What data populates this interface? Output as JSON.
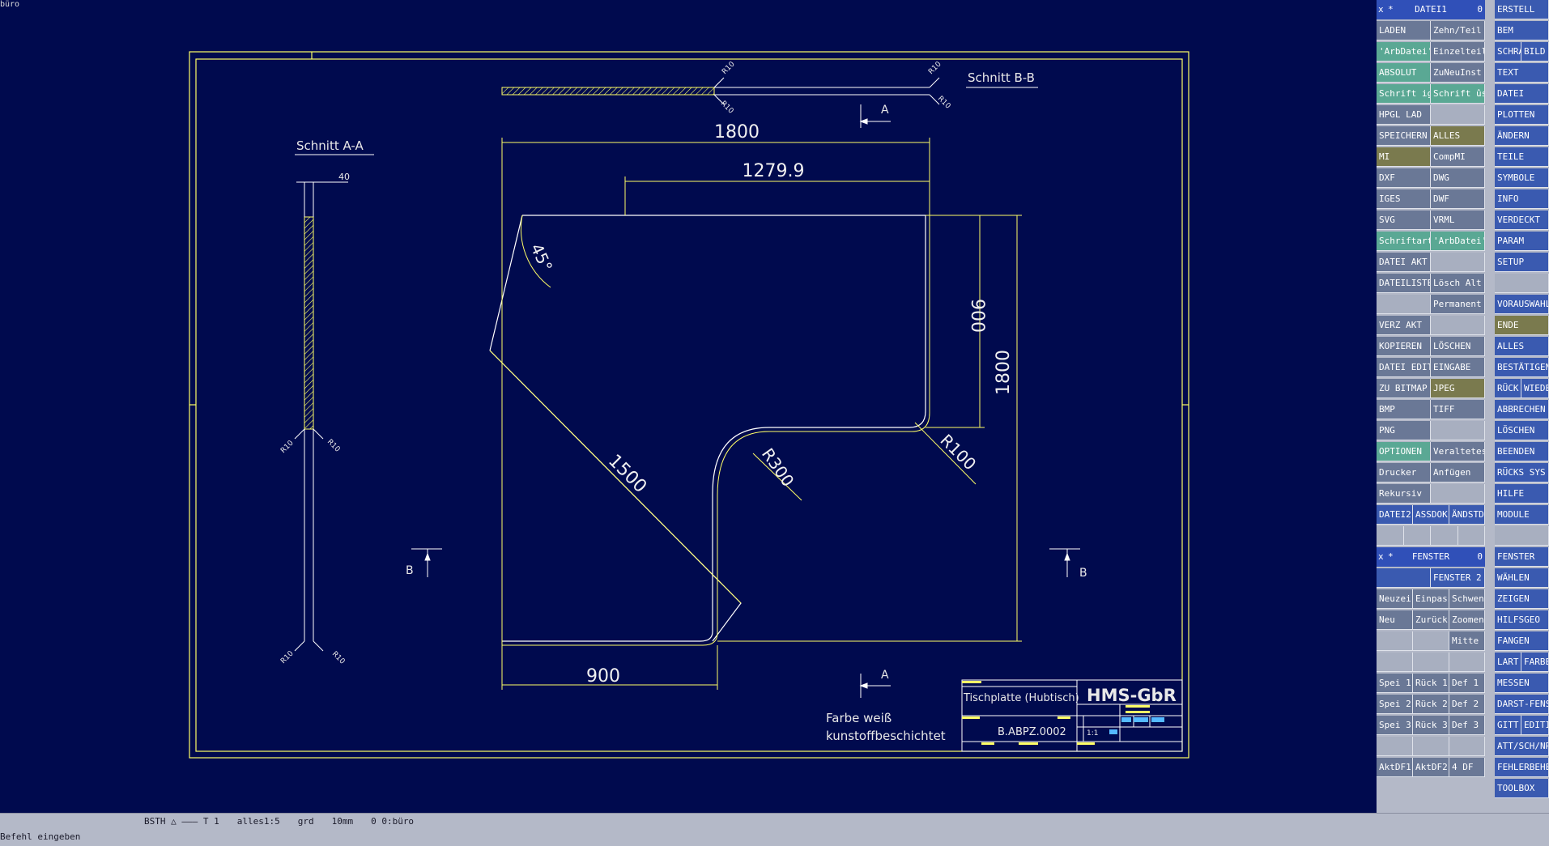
{
  "canvas_tag": "büro",
  "drawing": {
    "section_aa": "Schnitt A-A",
    "section_bb": "Schnitt B-B",
    "dims": {
      "d1800_top": "1800",
      "d1279": "1279.9",
      "d900_right": "900",
      "d1800_right": "1800",
      "d1500": "1500",
      "d900_bottom": "900",
      "angle": "45°",
      "r300": "R300",
      "r100": "R100",
      "thick": "40",
      "r10": "R10"
    },
    "markers": {
      "a": "A",
      "b": "B"
    },
    "note_line1": "Farbe weiß",
    "note_line2": "kunstoffbeschichtet",
    "title_block": {
      "company": "HMS-GbR",
      "part_name": "Tischplatte (Hubtisch)",
      "part_no": "B.ABPZ.0002",
      "scale": "1:1"
    }
  },
  "status": {
    "items": [
      "BSTH △ ——— T 1",
      "alles1:5",
      "grd",
      "10mm",
      "0 0:büro"
    ],
    "prompt": "Befehl eingeben"
  },
  "panel": {
    "datei1_header": {
      "x": "x",
      "star": "*",
      "title": "DATEI1",
      "num": "0"
    },
    "fenster_header": {
      "x": "x",
      "star": "*",
      "title": "FENSTER",
      "num": "0"
    },
    "left_buttons": [
      {
        "row": 1,
        "col": 0,
        "label": "LADEN",
        "color": "slate"
      },
      {
        "row": 1,
        "col": 1,
        "label": "Zehn/Teil",
        "color": "slate"
      },
      {
        "row": 2,
        "col": 0,
        "label": "'ArbDatei'",
        "color": "teal"
      },
      {
        "row": 2,
        "col": 1,
        "label": "Einzelteil",
        "color": "slate"
      },
      {
        "row": 3,
        "col": 0,
        "label": "ABSOLUT",
        "color": "teal"
      },
      {
        "row": 3,
        "col": 1,
        "label": "ZuNeuInst",
        "color": "slate"
      },
      {
        "row": 4,
        "col": 0,
        "label": "Schrift ig",
        "color": "teal"
      },
      {
        "row": 4,
        "col": 1,
        "label": "Schrift ûs",
        "color": "teal"
      },
      {
        "row": 5,
        "col": 0,
        "label": "HPGL LAD",
        "color": "slate"
      },
      {
        "row": 5,
        "col": 1,
        "label": "",
        "color": "empty"
      },
      {
        "row": 6,
        "col": 0,
        "label": "SPEICHERN",
        "color": "slate"
      },
      {
        "row": 6,
        "col": 1,
        "label": "ALLES",
        "color": "olive"
      },
      {
        "row": 7,
        "col": 0,
        "label": "MI",
        "color": "olive"
      },
      {
        "row": 7,
        "col": 1,
        "label": "CompMI",
        "color": "slate"
      },
      {
        "row": 8,
        "col": 0,
        "label": "DXF",
        "color": "slate"
      },
      {
        "row": 8,
        "col": 1,
        "label": "DWG",
        "color": "slate"
      },
      {
        "row": 9,
        "col": 0,
        "label": "IGES",
        "color": "slate"
      },
      {
        "row": 9,
        "col": 1,
        "label": "DWF",
        "color": "slate"
      },
      {
        "row": 10,
        "col": 0,
        "label": "SVG",
        "color": "slate"
      },
      {
        "row": 10,
        "col": 1,
        "label": "VRML",
        "color": "slate"
      },
      {
        "row": 11,
        "col": 0,
        "label": "Schriftart",
        "color": "teal"
      },
      {
        "row": 11,
        "col": 1,
        "label": "'ArbDatei'",
        "color": "teal"
      },
      {
        "row": 12,
        "col": 0,
        "label": "DATEI AKT",
        "color": "slate"
      },
      {
        "row": 12,
        "col": 1,
        "label": "",
        "color": "empty"
      },
      {
        "row": 13,
        "col": 0,
        "label": "DATEILISTE",
        "color": "slate"
      },
      {
        "row": 13,
        "col": 1,
        "label": "Lösch Alt",
        "color": "slate"
      },
      {
        "row": 14,
        "col": 0,
        "label": "",
        "color": "empty"
      },
      {
        "row": 14,
        "col": 1,
        "label": "Permanent",
        "color": "slate"
      },
      {
        "row": 15,
        "col": 0,
        "label": "VERZ AKT",
        "color": "slate"
      },
      {
        "row": 15,
        "col": 1,
        "label": "",
        "color": "empty"
      },
      {
        "row": 16,
        "col": 0,
        "label": "KOPIEREN",
        "color": "slate"
      },
      {
        "row": 16,
        "col": 1,
        "label": "LÖSCHEN",
        "color": "slate"
      },
      {
        "row": 17,
        "col": 0,
        "label": "DATEI EDIT",
        "color": "slate"
      },
      {
        "row": 17,
        "col": 1,
        "label": "EINGABE",
        "color": "slate"
      },
      {
        "row": 18,
        "col": 0,
        "label": "ZU BITMAP",
        "color": "slate"
      },
      {
        "row": 18,
        "col": 1,
        "label": "JPEG",
        "color": "olive"
      },
      {
        "row": 19,
        "col": 0,
        "label": "BMP",
        "color": "slate"
      },
      {
        "row": 19,
        "col": 1,
        "label": "TIFF",
        "color": "slate"
      },
      {
        "row": 20,
        "col": 0,
        "label": "PNG",
        "color": "slate"
      },
      {
        "row": 20,
        "col": 1,
        "label": "",
        "color": "empty"
      },
      {
        "row": 21,
        "col": 0,
        "label": "OPTIONEN",
        "color": "teal"
      },
      {
        "row": 21,
        "col": 1,
        "label": "Veraltetes",
        "color": "slate"
      },
      {
        "row": 22,
        "col": 0,
        "label": "Drucker",
        "color": "slate"
      },
      {
        "row": 22,
        "col": 1,
        "label": "Anfügen",
        "color": "slate"
      },
      {
        "row": 23,
        "col": 0,
        "label": "Rekursiv",
        "color": "slate"
      },
      {
        "row": 23,
        "col": 1,
        "label": "",
        "color": "empty"
      }
    ],
    "datei_row": [
      "DATEI2",
      "ASSDOK",
      "ÄNDSTD"
    ],
    "fenster2": "FENSTER 2",
    "win_rows": [
      [
        "Neuzei",
        "Einpass",
        "Schwen"
      ],
      [
        "Neu",
        "Zurück",
        "Zoomen"
      ],
      [
        "",
        "",
        "Mitte"
      ],
      [
        "",
        "",
        ""
      ],
      [
        "Spei 1",
        "Rück 1",
        "Def 1"
      ],
      [
        "Spei 2",
        "Rück 2",
        "Def 2"
      ],
      [
        "Spei 3",
        "Rück 3",
        "Def 3"
      ],
      [
        "",
        "",
        ""
      ],
      [
        "AktDF1",
        "AktDF2",
        "4 DF"
      ]
    ],
    "right_buttons": [
      {
        "row": 0,
        "label": "ERSTELL",
        "color": "blue"
      },
      {
        "row": 1,
        "label": "BEM",
        "color": "blue"
      },
      {
        "row": 2,
        "split": [
          "SCHRA",
          "BILD"
        ],
        "color": "blue"
      },
      {
        "row": 3,
        "label": "TEXT",
        "color": "blue"
      },
      {
        "row": 4,
        "label": "DATEI",
        "color": "blue"
      },
      {
        "row": 5,
        "label": "PLOTTEN",
        "color": "blue"
      },
      {
        "row": 6,
        "label": "ÄNDERN",
        "color": "blue"
      },
      {
        "row": 7,
        "label": "TEILE",
        "color": "blue"
      },
      {
        "row": 8,
        "label": "SYMBOLE",
        "color": "blue"
      },
      {
        "row": 9,
        "label": "INFO",
        "color": "blue"
      },
      {
        "row": 10,
        "label": "VERDECKT",
        "color": "blue"
      },
      {
        "row": 11,
        "label": "PARAM",
        "color": "blue"
      },
      {
        "row": 12,
        "label": "SETUP",
        "color": "blue"
      },
      {
        "row": 13,
        "label": "",
        "color": "empty"
      },
      {
        "row": 14,
        "label": "VORAUSWAHL",
        "color": "blue"
      },
      {
        "row": 15,
        "label": "ENDE",
        "color": "olive"
      },
      {
        "row": 16,
        "label": "ALLES",
        "color": "blue"
      },
      {
        "row": 17,
        "label": "BESTÄTIGEN",
        "color": "blue"
      },
      {
        "row": 18,
        "split": [
          "RÜCK",
          "WIEDE"
        ],
        "color": "blue"
      },
      {
        "row": 19,
        "label": "ABBRECHEN",
        "color": "blue"
      },
      {
        "row": 20,
        "label": "LÖSCHEN",
        "color": "blue"
      },
      {
        "row": 21,
        "label": "BEENDEN",
        "color": "blue"
      },
      {
        "row": 22,
        "label": "RÜCKS SYS",
        "color": "blue"
      },
      {
        "row": 23,
        "label": "HILFE",
        "color": "blue"
      },
      {
        "row": 24,
        "label": "MODULE",
        "color": "blue"
      },
      {
        "row": 25,
        "label": "",
        "color": "empty"
      },
      {
        "row": 26,
        "label": "FENSTER",
        "color": "blue"
      },
      {
        "row": 27,
        "label": "WÄHLEN",
        "color": "blue"
      },
      {
        "row": 28,
        "label": "ZEIGEN",
        "color": "blue"
      },
      {
        "row": 29,
        "label": "HILFSGEO",
        "color": "blue"
      },
      {
        "row": 30,
        "label": "FANGEN",
        "color": "blue"
      },
      {
        "row": 31,
        "split": [
          "LART",
          "FARBE"
        ],
        "color": "blue"
      },
      {
        "row": 32,
        "label": "MESSEN",
        "color": "blue"
      },
      {
        "row": 33,
        "label": "DARST-FENS",
        "color": "blue"
      },
      {
        "row": 34,
        "split": [
          "GITT",
          "EDITI"
        ],
        "color": "blue"
      },
      {
        "row": 35,
        "label": "ATT/SCH/NR",
        "color": "blue"
      },
      {
        "row": 36,
        "label": "FEHLERBEHE",
        "color": "blue"
      },
      {
        "row": 37,
        "label": "TOOLBOX",
        "color": "blue"
      }
    ]
  }
}
